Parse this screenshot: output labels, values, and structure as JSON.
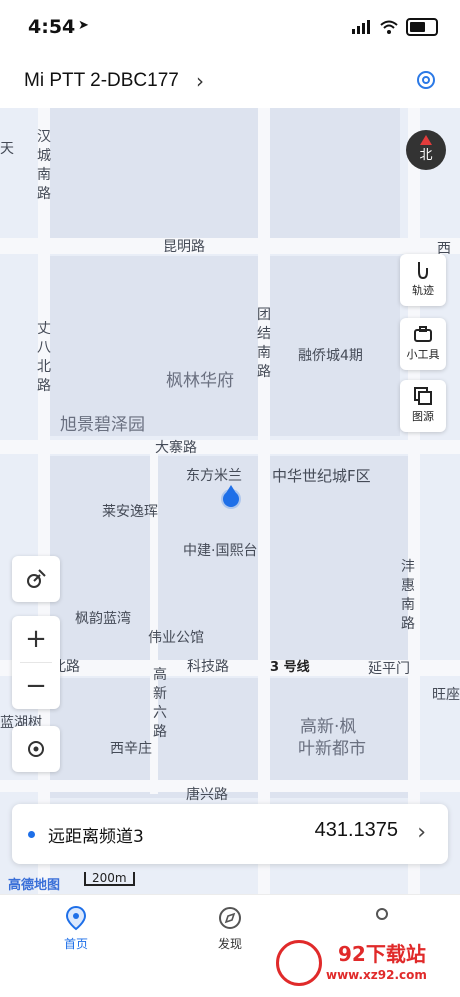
{
  "status_bar": {
    "time": "4:54"
  },
  "header": {
    "title": "Mi PTT 2-DBC177"
  },
  "map": {
    "labels": {
      "kunming_rd": "昆明路",
      "datai_rd": "大寨路",
      "keji_rd": "科技路",
      "tangxing_rd": "唐兴路",
      "line3": "3 号线",
      "yanpingmen": "延平门",
      "fenglin": "枫林华府",
      "xujing": "旭景碧泽园",
      "rongqiao": "融侨城4期",
      "dongfang": "东方米兰",
      "zhonghua": "中华世纪城F区",
      "laian": "莱安逸珲",
      "zhongjian": "中建·国熙台",
      "fengyun": "枫韵蓝湾",
      "weiye": "伟业公馆",
      "xixinzhuang": "西辛庄",
      "gaoxin_feng": "高新·枫",
      "yexin": "叶新都市",
      "lanhu": "蓝湖树",
      "wangzuo": "旺座",
      "babei": "八北路",
      "tian": "天",
      "xi": "西"
    },
    "vertical_labels": {
      "hancheng": "汉城南路",
      "tuanjie": "团结南路",
      "zhangba": "丈八北路",
      "fenghui": "沣惠南路",
      "gaoxin6": "高新六路"
    },
    "compass": "北",
    "scale": "200m",
    "logo": "高德地图"
  },
  "tools": {
    "track": "轨迹",
    "toolbox": "小工具",
    "layers": "图源"
  },
  "zoom": {
    "in": "+",
    "out": "−"
  },
  "channel": {
    "name": "远距离频道3",
    "frequency": "431.1375"
  },
  "tabs": {
    "home": "首页",
    "discover": "发现"
  },
  "watermark": {
    "title": "92下载站",
    "url": "www.xz92.com"
  },
  "colors": {
    "accent": "#1e6fe8",
    "map_bg": "#e9eef7"
  }
}
